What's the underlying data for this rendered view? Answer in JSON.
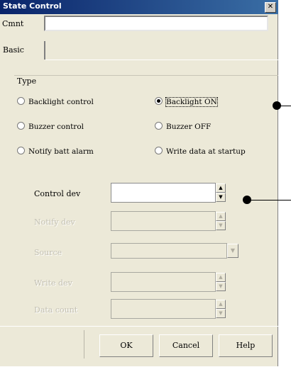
{
  "window": {
    "title": "State Control",
    "close_glyph": "✕"
  },
  "comment": {
    "label": "Cmnt",
    "value": ""
  },
  "tabs": [
    {
      "label": "Basic"
    }
  ],
  "type_group": {
    "label": "Type",
    "options": [
      {
        "label": "Backlight control",
        "selected": false
      },
      {
        "label": "Backlight ON",
        "selected": true
      },
      {
        "label": "Buzzer control",
        "selected": false
      },
      {
        "label": "Buzzer OFF",
        "selected": false
      },
      {
        "label": "Notify batt alarm",
        "selected": false
      },
      {
        "label": "Write data at startup",
        "selected": false
      }
    ]
  },
  "fields": {
    "control_dev": {
      "label": "Control dev",
      "value": "",
      "enabled": true
    },
    "notify_dev": {
      "label": "Notify dev",
      "enabled": false
    },
    "source": {
      "label": "Source",
      "enabled": false
    },
    "write_dev": {
      "label": "Write dev",
      "enabled": false
    },
    "data_count": {
      "label": "Data count",
      "enabled": false
    }
  },
  "buttons": {
    "ok": "OK",
    "cancel": "Cancel",
    "help": "Help"
  },
  "icons": {
    "spin_up": "▲",
    "spin_down": "▼",
    "combo_arrow": "▼"
  }
}
